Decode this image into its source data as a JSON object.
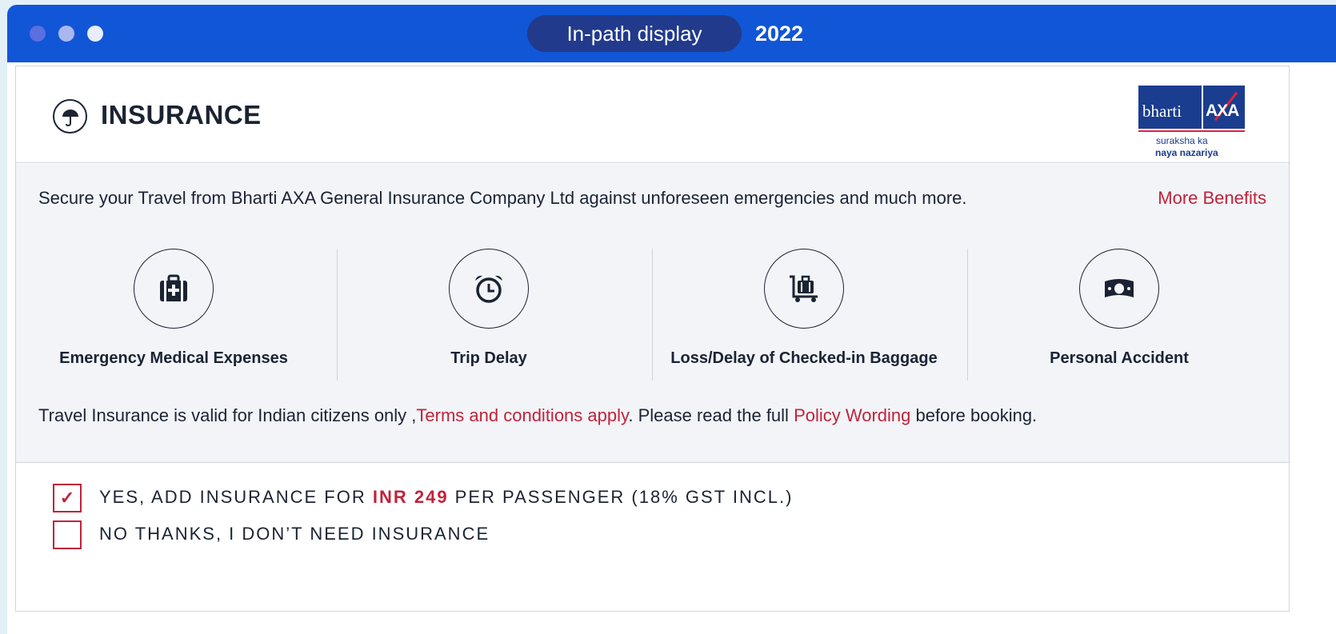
{
  "window": {
    "pill_label": "In-path display",
    "year": "2022"
  },
  "header": {
    "title": "INSURANCE",
    "icon": "umbrella-icon",
    "logo": {
      "brand_left": "bharti",
      "brand_right": "AXA",
      "tagline_1": "suraksha ka",
      "tagline_2": "naya nazariya"
    }
  },
  "body": {
    "intro": "Secure your Travel from Bharti AXA General Insurance Company Ltd against unforeseen emergencies and much more.",
    "more_benefits": "More Benefits",
    "benefits": [
      {
        "label": "Emergency Medical Expenses",
        "icon": "medical-kit-icon"
      },
      {
        "label": "Trip Delay",
        "icon": "alarm-clock-icon"
      },
      {
        "label": "Loss/Delay of Checked-in Baggage",
        "icon": "baggage-cart-icon"
      },
      {
        "label": "Personal Accident",
        "icon": "money-icon"
      }
    ],
    "validity": {
      "prefix": "Travel Insurance is valid for Indian citizens only ,",
      "terms_link": "Terms and conditions apply",
      "middle": ". Please read the full ",
      "policy_link": "Policy Wording",
      "suffix": " before booking."
    }
  },
  "options": {
    "yes": {
      "checked": true,
      "check_mark": "✓",
      "prefix": "YES, ADD INSURANCE FOR ",
      "price": "INR 249",
      "suffix": " PER PASSENGER (18% GST INCL.)"
    },
    "no": {
      "checked": false,
      "label": "NO THANKS, I DON’T NEED INSURANCE"
    }
  },
  "colors": {
    "title_bar": "#1156d6",
    "pill": "#213a8c",
    "accent_red": "#c0233a",
    "text_dark": "#1b2333",
    "panel_bg": "#f2f4f8"
  }
}
